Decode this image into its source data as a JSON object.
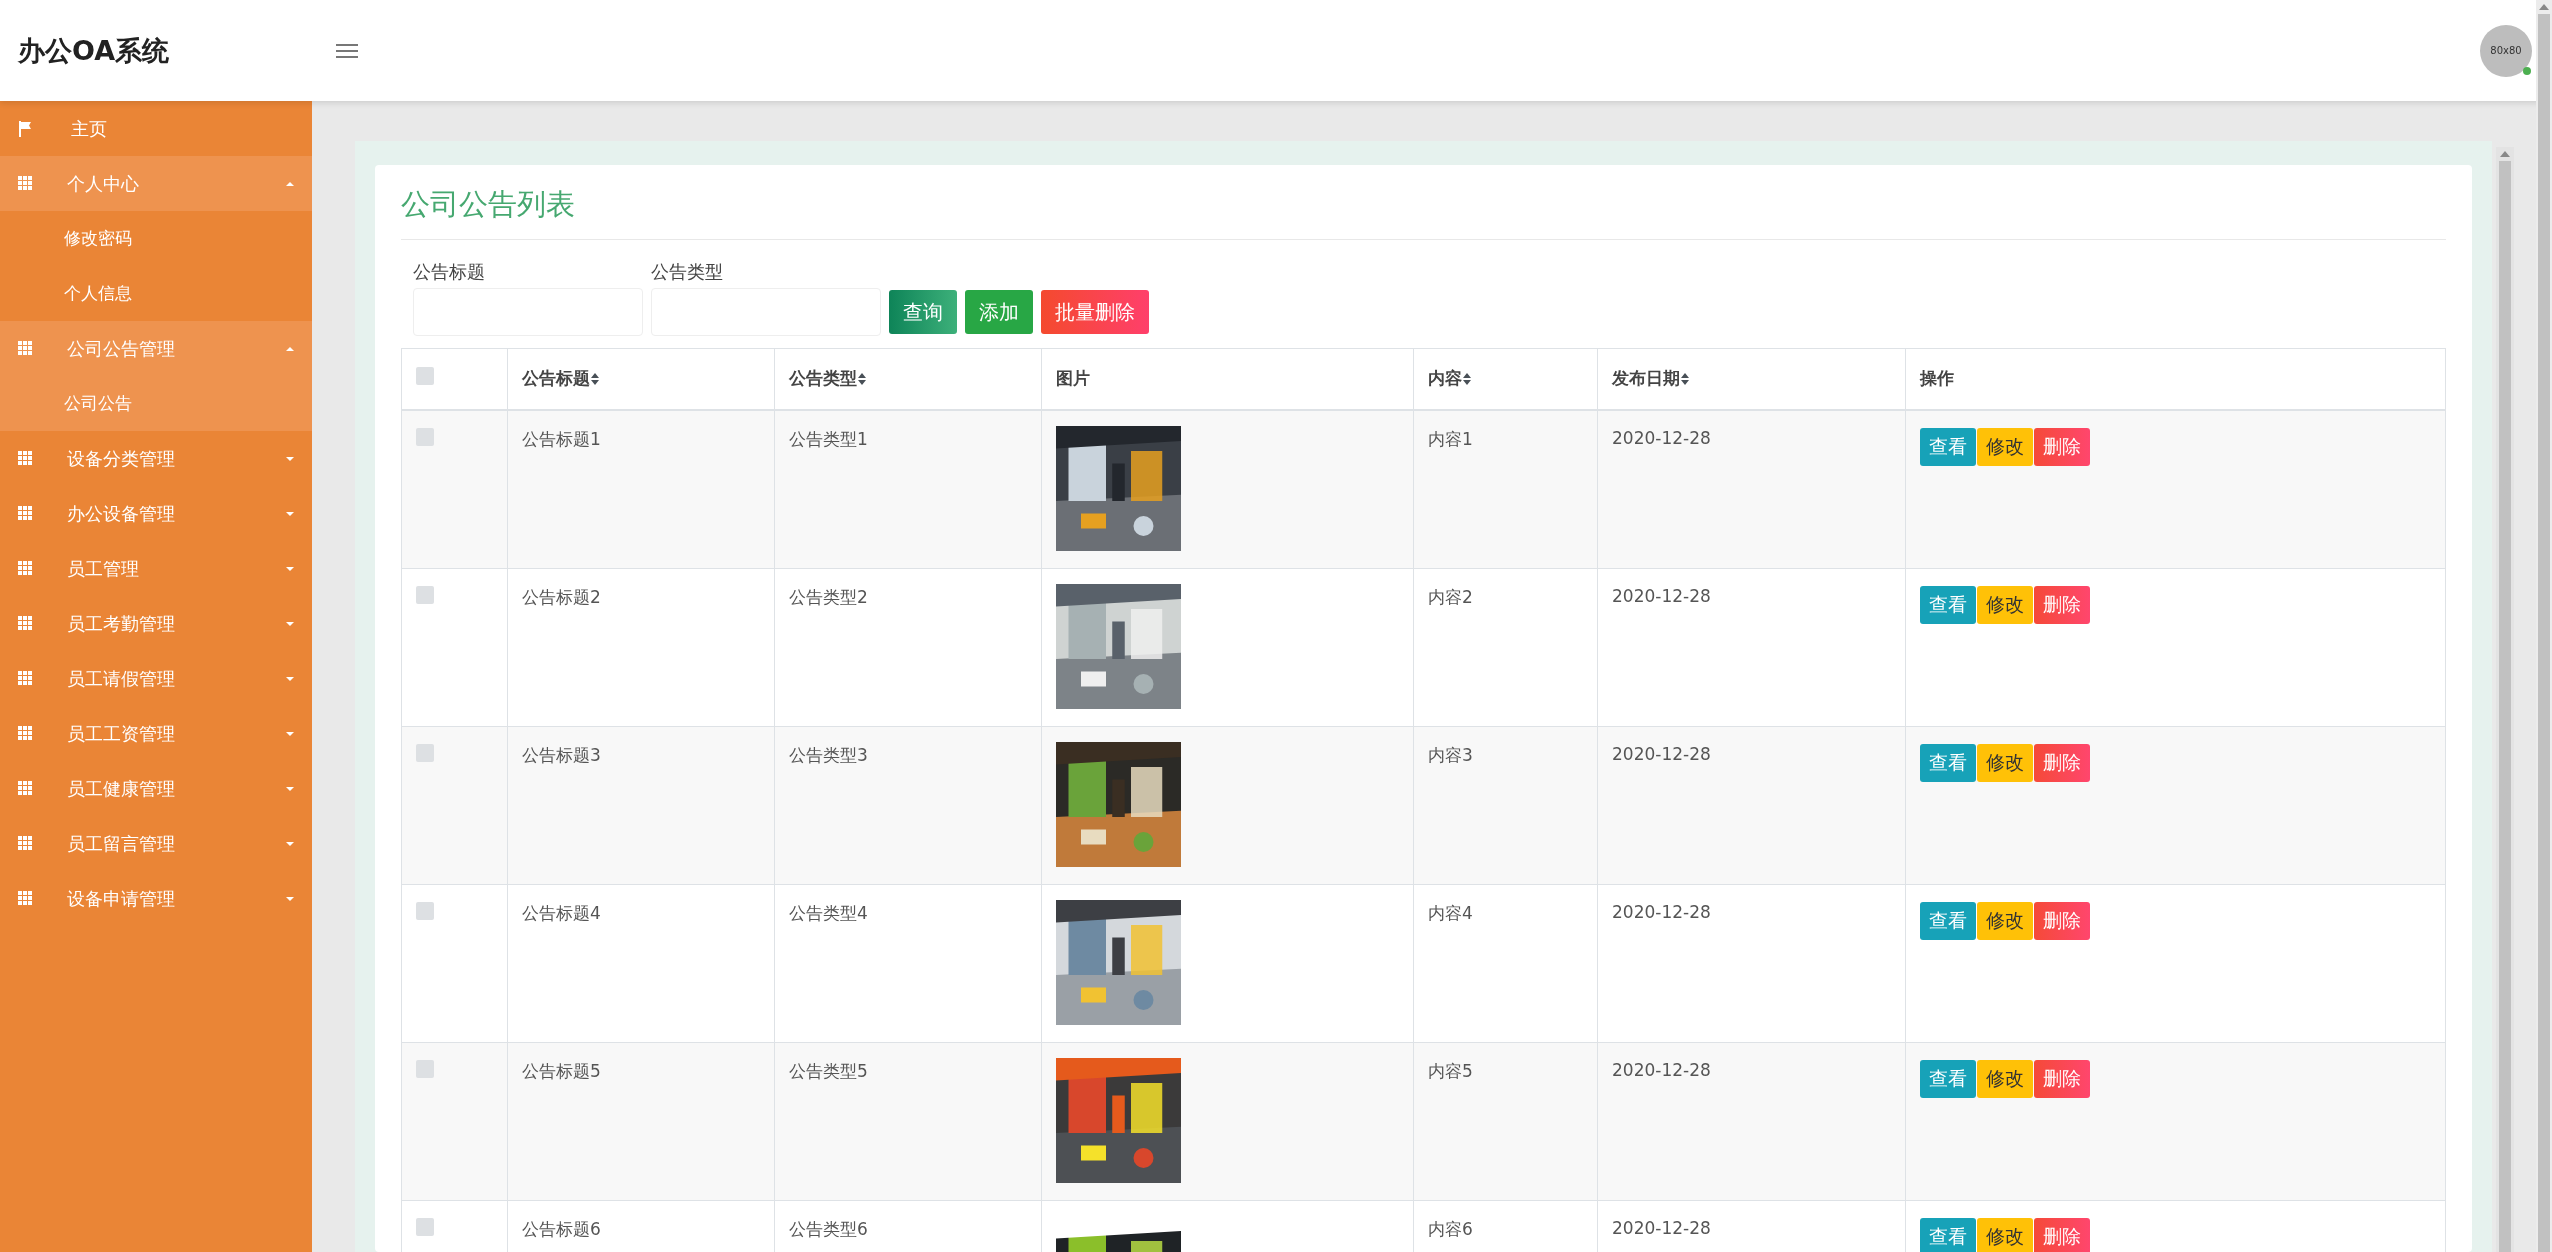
{
  "app_title": "办公OA系统",
  "avatar": {
    "label": "80x80",
    "online": true
  },
  "sidebar": {
    "items": [
      {
        "kind": "link",
        "label": "主页",
        "expanded": false
      },
      {
        "kind": "group",
        "label": "个人中心",
        "expanded": true,
        "children": [
          {
            "label": "修改密码",
            "selected": false
          },
          {
            "label": "个人信息",
            "selected": false
          }
        ]
      },
      {
        "kind": "group",
        "label": "公司公告管理",
        "expanded": true,
        "children": [
          {
            "label": "公司公告",
            "selected": true
          }
        ]
      },
      {
        "kind": "group",
        "label": "设备分类管理",
        "expanded": false
      },
      {
        "kind": "group",
        "label": "办公设备管理",
        "expanded": false
      },
      {
        "kind": "group",
        "label": "员工管理",
        "expanded": false
      },
      {
        "kind": "group",
        "label": "员工考勤管理",
        "expanded": false
      },
      {
        "kind": "group",
        "label": "员工请假管理",
        "expanded": false
      },
      {
        "kind": "group",
        "label": "员工工资管理",
        "expanded": false
      },
      {
        "kind": "group",
        "label": "员工健康管理",
        "expanded": false
      },
      {
        "kind": "group",
        "label": "员工留言管理",
        "expanded": false
      },
      {
        "kind": "group",
        "label": "设备申请管理",
        "expanded": false
      }
    ]
  },
  "page_title": "公司公告列表",
  "filters": [
    {
      "label": "公告标题"
    },
    {
      "label": "公告类型"
    }
  ],
  "actions": [
    {
      "kind": "search",
      "label": "查询"
    },
    {
      "kind": "add",
      "label": "添加"
    },
    {
      "kind": "delete",
      "label": "批量删除"
    }
  ],
  "table": {
    "columns": [
      {
        "kind": "checkbox",
        "checked": false
      },
      {
        "label": "公告标题",
        "sortable": true
      },
      {
        "label": "公告类型",
        "sortable": true
      },
      {
        "label": "图片",
        "sortable": false
      },
      {
        "label": "内容",
        "sortable": true
      },
      {
        "label": "发布日期",
        "sortable": true
      },
      {
        "label": "操作",
        "sortable": false
      }
    ],
    "rows": [
      {
        "checked": false,
        "title": "公告标题1",
        "type": "公告类型1",
        "content": "内容1",
        "date": "2020-12-28",
        "buttons": [
          {
            "kind": "view",
            "label": "查看"
          },
          {
            "kind": "edit",
            "label": "修改"
          },
          {
            "kind": "delete",
            "label": "删除"
          }
        ]
      },
      {
        "checked": false,
        "title": "公告标题2",
        "type": "公告类型2",
        "content": "内容2",
        "date": "2020-12-28",
        "buttons": [
          {
            "kind": "view",
            "label": "查看"
          },
          {
            "kind": "edit",
            "label": "修改"
          },
          {
            "kind": "delete",
            "label": "删除"
          }
        ]
      },
      {
        "checked": false,
        "title": "公告标题3",
        "type": "公告类型3",
        "content": "内容3",
        "date": "2020-12-28",
        "buttons": [
          {
            "kind": "view",
            "label": "查看"
          },
          {
            "kind": "edit",
            "label": "修改"
          },
          {
            "kind": "delete",
            "label": "删除"
          }
        ]
      },
      {
        "checked": false,
        "title": "公告标题4",
        "type": "公告类型4",
        "content": "内容4",
        "date": "2020-12-28",
        "buttons": [
          {
            "kind": "view",
            "label": "查看"
          },
          {
            "kind": "edit",
            "label": "修改"
          },
          {
            "kind": "delete",
            "label": "删除"
          }
        ]
      },
      {
        "checked": false,
        "title": "公告标题5",
        "type": "公告类型5",
        "content": "内容5",
        "date": "2020-12-28",
        "buttons": [
          {
            "kind": "view",
            "label": "查看"
          },
          {
            "kind": "edit",
            "label": "修改"
          },
          {
            "kind": "delete",
            "label": "删除"
          }
        ]
      },
      {
        "checked": false,
        "title": "公告标题6",
        "type": "公告类型6",
        "content": "内容6",
        "date": "2020-12-28",
        "buttons": [
          {
            "kind": "view",
            "label": "查看"
          },
          {
            "kind": "edit",
            "label": "修改"
          },
          {
            "kind": "delete",
            "label": "删除"
          }
        ]
      }
    ]
  }
}
